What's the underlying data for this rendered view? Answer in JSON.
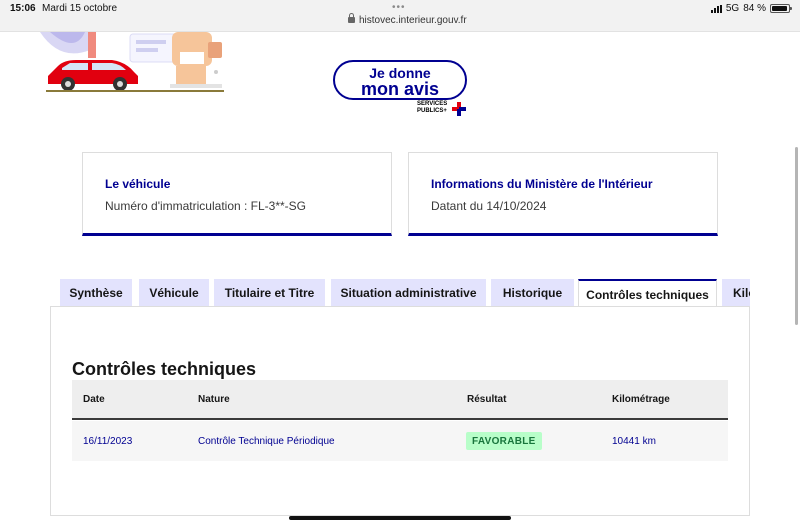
{
  "status_bar": {
    "time": "15:06",
    "date": "Mardi 15 octobre",
    "url": "histovec.interieur.gouv.fr",
    "network": "5G",
    "battery": "84 %",
    "battery_level": 0.84
  },
  "feedback_button": {
    "line1": "Je donne",
    "line2": "mon avis",
    "caption_line1": "SERVICES",
    "caption_line2": "PUBLICS+"
  },
  "cards": {
    "vehicle": {
      "title": "Le véhicule",
      "text": "Numéro d'immatriculation : FL-3**-SG"
    },
    "ministry": {
      "title": "Informations du Ministère de l'Intérieur",
      "text": "Datant du 14/10/2024"
    }
  },
  "tabs": [
    {
      "label": "Synthèse"
    },
    {
      "label": "Véhicule"
    },
    {
      "label": "Titulaire et Titre"
    },
    {
      "label": "Situation administrative"
    },
    {
      "label": "Historique"
    },
    {
      "label": "Contrôles techniques",
      "active": true
    },
    {
      "label": "Kilométrage"
    }
  ],
  "section": {
    "title": "Contrôles techniques",
    "columns": [
      "Date",
      "Nature",
      "Résultat",
      "Kilométrage"
    ],
    "rows": [
      {
        "date": "16/11/2023",
        "nature": "Contrôle Technique Périodique",
        "result": "FAVORABLE",
        "km": "10441 km"
      }
    ]
  },
  "colors": {
    "primary": "#000091",
    "tab_bg": "#e3e3fd",
    "badge_bg": "#b8fec9",
    "badge_text": "#18753c",
    "accent_red": "#e1000f"
  }
}
